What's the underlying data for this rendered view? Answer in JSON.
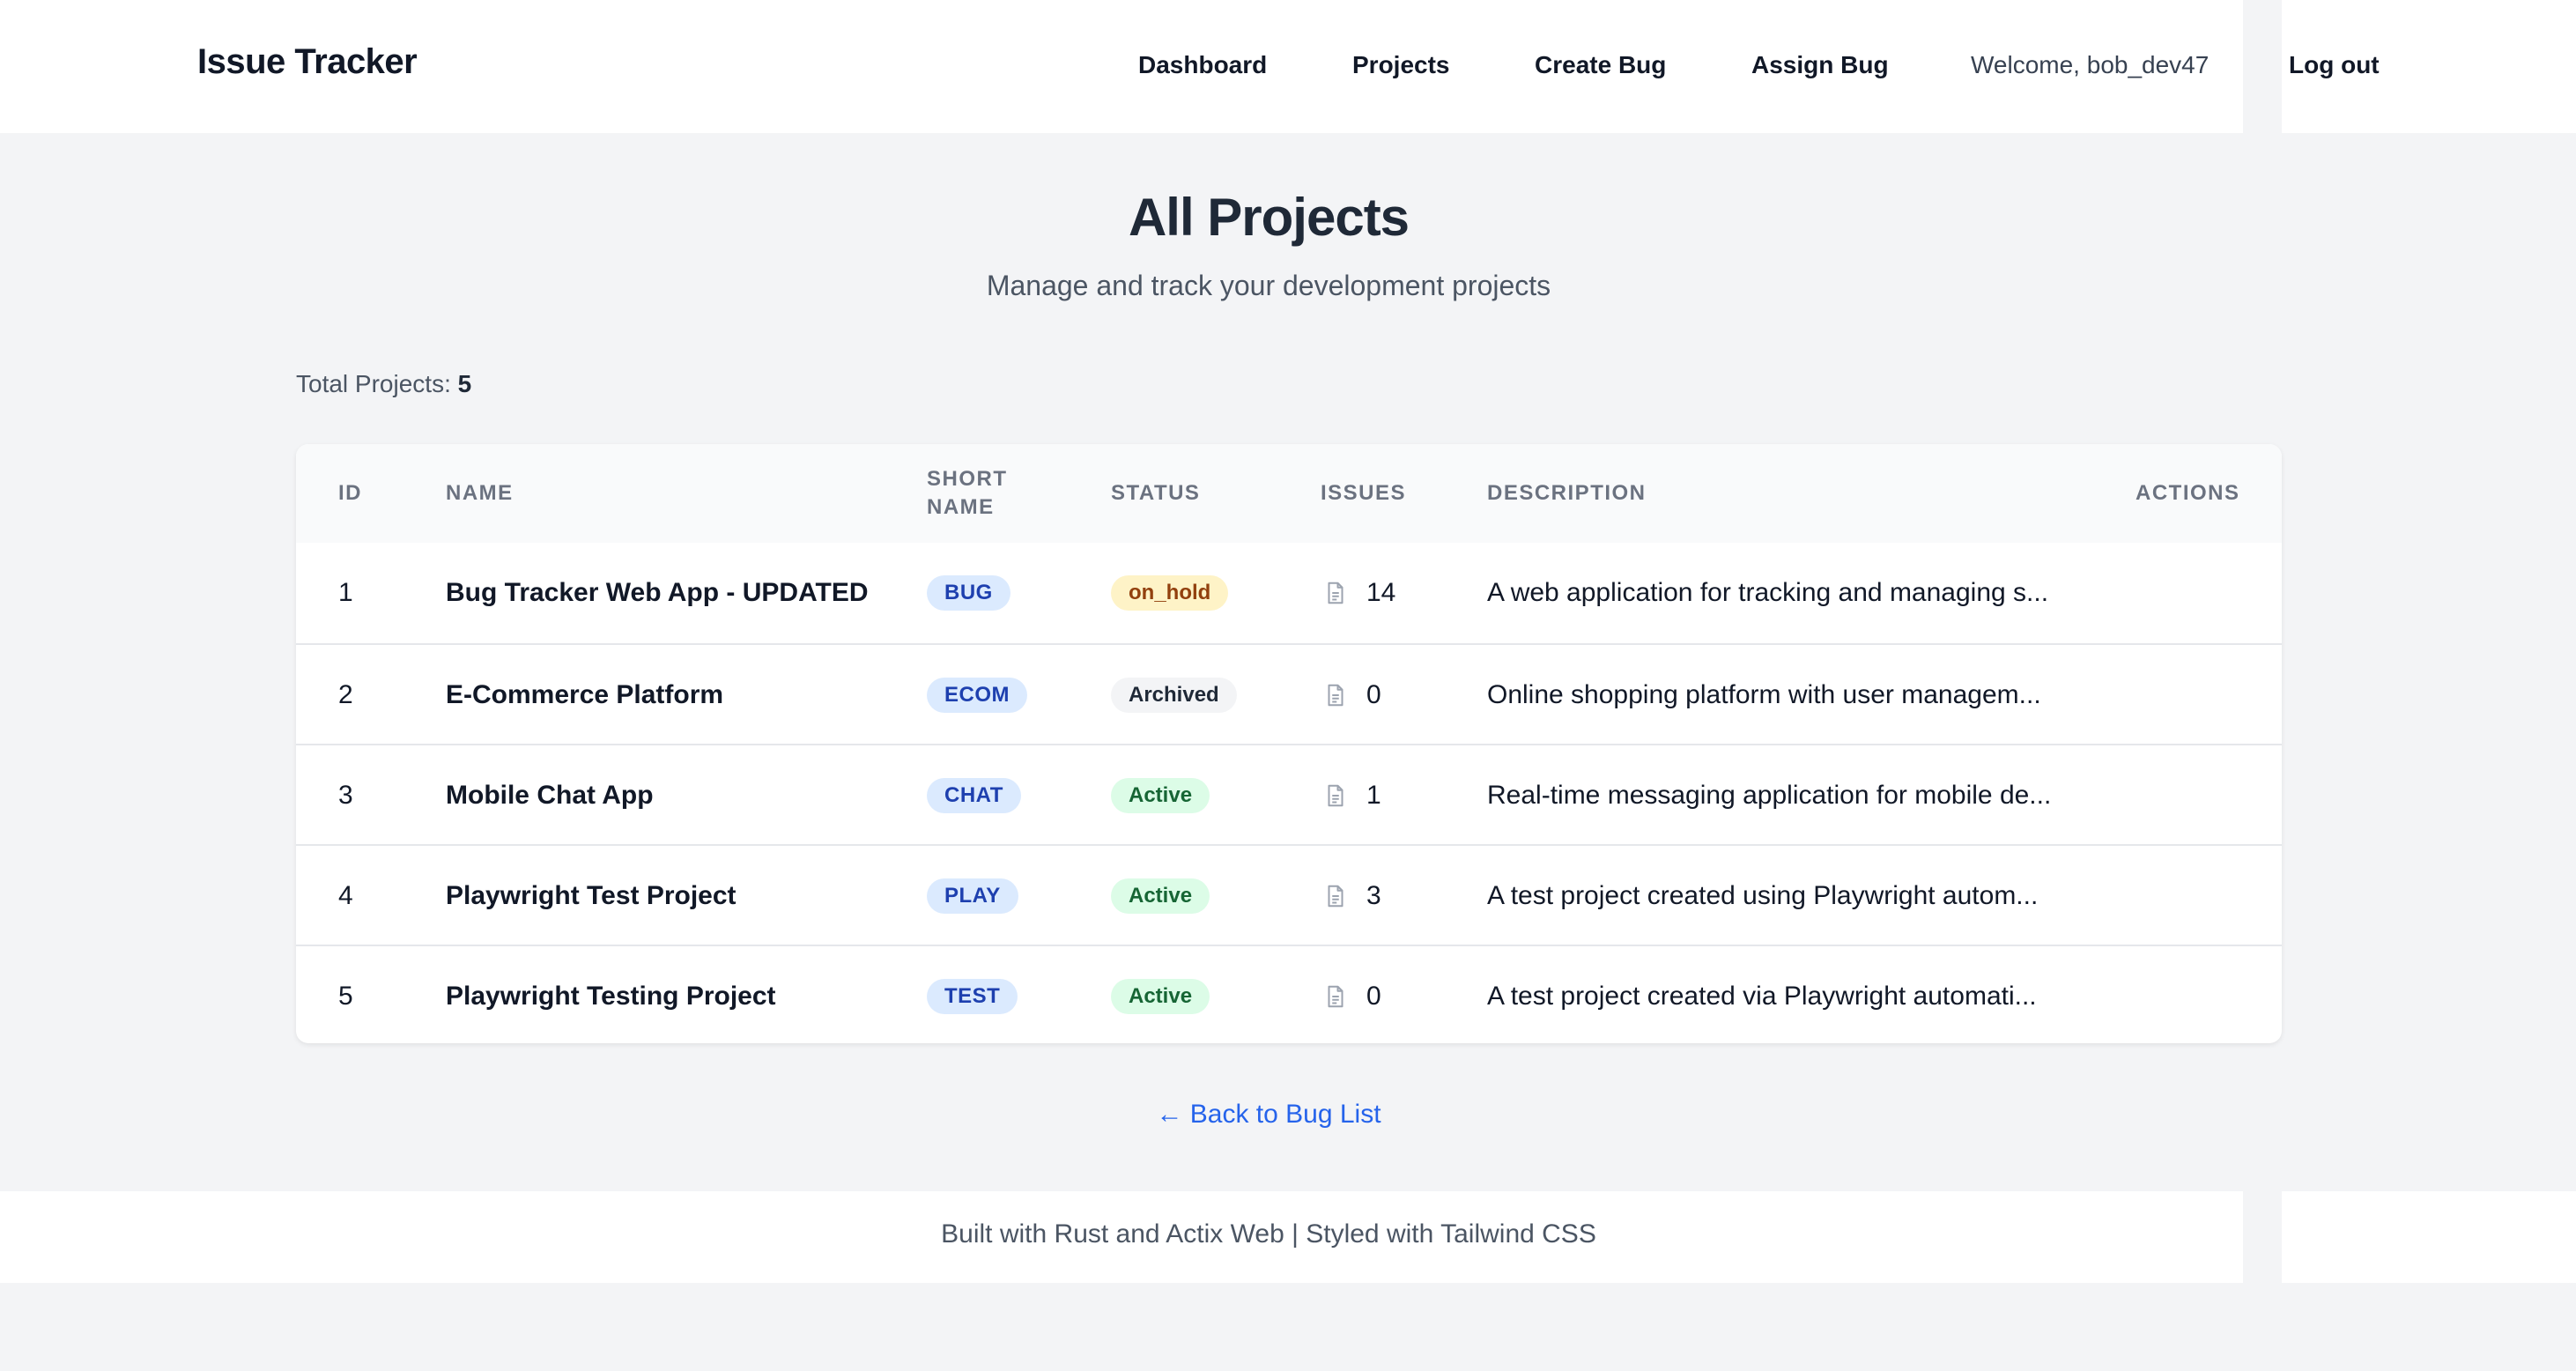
{
  "header": {
    "brand": "Issue Tracker",
    "nav": {
      "dashboard": "Dashboard",
      "projects": "Projects",
      "create_bug": "Create Bug",
      "assign_bug": "Assign Bug"
    },
    "welcome": "Welcome, bob_dev47",
    "logout": "Log out"
  },
  "main": {
    "title": "All Projects",
    "subtitle": "Manage and track your development projects",
    "total_label": "Total Projects: ",
    "total_value": "5",
    "table": {
      "columns": {
        "id": "ID",
        "name": "NAME",
        "short_name_line1": "SHORT",
        "short_name_line2": "NAME",
        "status": "STATUS",
        "issues": "ISSUES",
        "description": "DESCRIPTION",
        "actions": "ACTIONS"
      },
      "rows": [
        {
          "id": "1",
          "name": "Bug Tracker Web App - UPDATED",
          "short": "BUG",
          "status": "on_hold",
          "status_kind": "hold",
          "issues": "14",
          "description": "A web application for tracking and managing s..."
        },
        {
          "id": "2",
          "name": "E-Commerce Platform",
          "short": "ECOM",
          "status": "Archived",
          "status_kind": "archived",
          "issues": "0",
          "description": "Online shopping platform with user managem..."
        },
        {
          "id": "3",
          "name": "Mobile Chat App",
          "short": "CHAT",
          "status": "Active",
          "status_kind": "active",
          "issues": "1",
          "description": "Real-time messaging application for mobile de..."
        },
        {
          "id": "4",
          "name": "Playwright Test Project",
          "short": "PLAY",
          "status": "Active",
          "status_kind": "active",
          "issues": "3",
          "description": "A test project created using Playwright autom..."
        },
        {
          "id": "5",
          "name": "Playwright Testing Project",
          "short": "TEST",
          "status": "Active",
          "status_kind": "active",
          "issues": "0",
          "description": "A test project created via Playwright automati..."
        }
      ]
    },
    "back_link": "← Back to Bug List"
  },
  "footer": {
    "text": "Built with Rust and Actix Web | Styled with Tailwind CSS"
  },
  "colors": {
    "background": "#f3f4f6",
    "link": "#2563eb",
    "status_hold": "#fef3c7",
    "status_active": "#dcfce7",
    "short_badge": "#dbeafe"
  }
}
